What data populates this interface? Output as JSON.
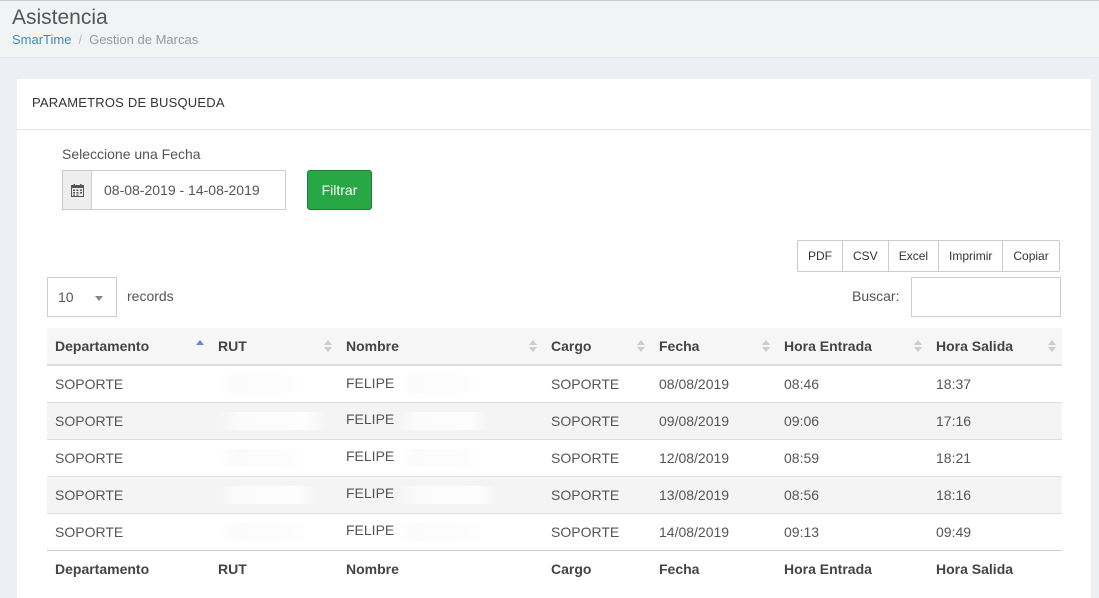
{
  "header": {
    "title": "Asistencia",
    "breadcrumb": {
      "home": "SmarTime",
      "separator": "/",
      "current": "Gestion de Marcas"
    }
  },
  "box": {
    "title": "PARAMETROS DE BUSQUEDA",
    "date_label": "Seleccione una Fecha",
    "date_value": "08-08-2019 - 14-08-2019",
    "date_icon": "calendar-icon",
    "filter_button": "Filtrar"
  },
  "export_buttons": [
    "PDF",
    "CSV",
    "Excel",
    "Imprimir",
    "Copiar"
  ],
  "table_controls": {
    "length_value": "10",
    "records_label": "records",
    "search_label": "Buscar:",
    "search_value": ""
  },
  "table": {
    "columns": [
      "Departamento",
      "RUT",
      "Nombre",
      "Cargo",
      "Fecha",
      "Hora Entrada",
      "Hora Salida"
    ],
    "sorted_column": "Departamento",
    "sort_direction": "asc",
    "rows": [
      [
        "SOPORTE",
        "",
        "FELIPE",
        "SOPORTE",
        "08/08/2019",
        "08:46",
        "18:37"
      ],
      [
        "SOPORTE",
        "",
        "FELIPE",
        "SOPORTE",
        "09/08/2019",
        "09:06",
        "17:16"
      ],
      [
        "SOPORTE",
        "",
        "FELIPE",
        "SOPORTE",
        "12/08/2019",
        "08:59",
        "18:21"
      ],
      [
        "SOPORTE",
        "",
        "FELIPE",
        "SOPORTE",
        "13/08/2019",
        "08:56",
        "18:16"
      ],
      [
        "SOPORTE",
        "",
        "FELIPE",
        "SOPORTE",
        "14/08/2019",
        "09:13",
        "09:49"
      ]
    ]
  },
  "colors": {
    "accent_link": "#3c8dbc",
    "filter_button": "#28a745",
    "sort_active": "#6f7fd6"
  }
}
